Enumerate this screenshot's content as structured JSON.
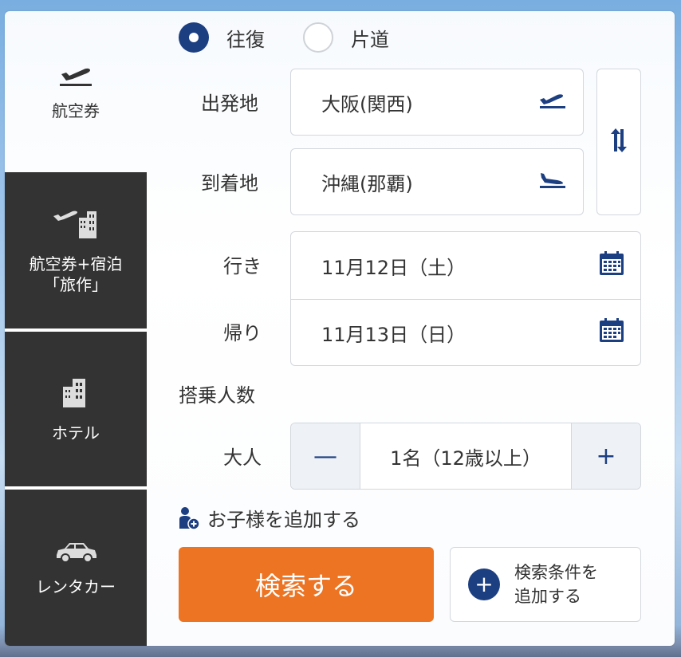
{
  "sidebar": {
    "tabs": [
      {
        "label": "航空券",
        "icon": "plane-icon",
        "active": true
      },
      {
        "label_line1": "航空券+宿泊",
        "label_line2": "「旅作」",
        "icon": "plane-hotel-icon"
      },
      {
        "label": "ホテル",
        "icon": "hotel-icon"
      },
      {
        "label": "レンタカー",
        "icon": "car-icon"
      }
    ]
  },
  "trip_type": {
    "options": [
      {
        "label": "往復",
        "selected": true
      },
      {
        "label": "片道",
        "selected": false
      }
    ]
  },
  "departure": {
    "label": "出発地",
    "value": "大阪(関西)",
    "icon": "plane-takeoff-icon"
  },
  "arrival": {
    "label": "到着地",
    "value": "沖縄(那覇)",
    "icon": "plane-landing-icon"
  },
  "swap": {
    "icon": "swap-arrows-icon"
  },
  "outbound": {
    "label": "行き",
    "value": "11月12日（土）",
    "icon": "calendar-icon"
  },
  "return": {
    "label": "帰り",
    "value": "11月13日（日）",
    "icon": "calendar-icon"
  },
  "passengers": {
    "heading": "搭乗人数",
    "adult_label": "大人",
    "minus": "—",
    "plus": "+",
    "adult_value": "1名（12歳以上）"
  },
  "add_child": {
    "label": "お子様を追加する",
    "icon": "child-add-icon"
  },
  "search_button": {
    "label": "検索する"
  },
  "more_conditions": {
    "line1": "検索条件を",
    "line2": "追加する",
    "icon": "plus-circle-icon"
  },
  "colors": {
    "primary": "#1c3f82",
    "accent": "#ec7423",
    "sidebar_dark": "#333333"
  }
}
